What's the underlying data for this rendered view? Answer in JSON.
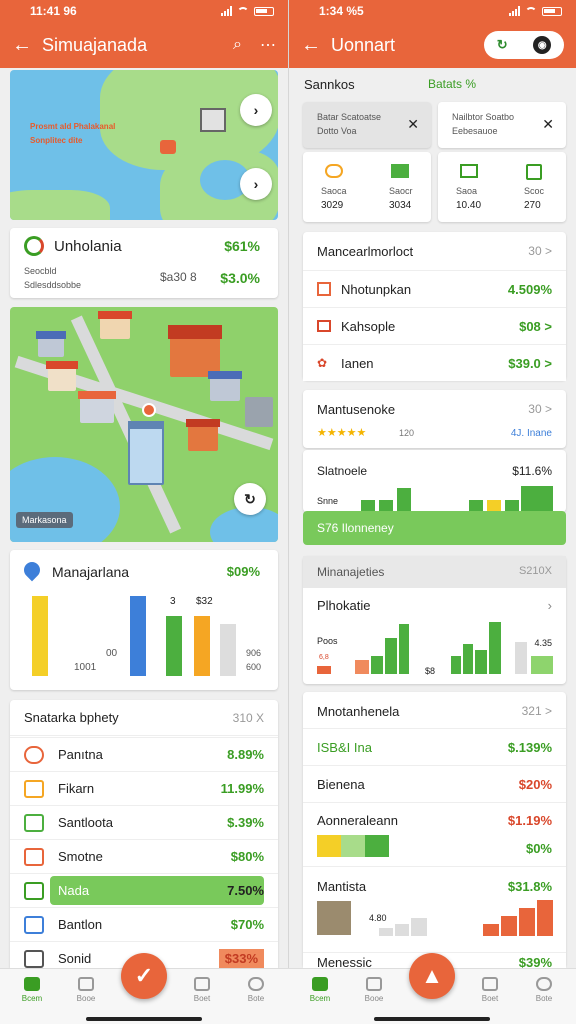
{
  "left": {
    "status": {
      "time": "11:41 96"
    },
    "appbar": {
      "title": "Simuajanada",
      "search_icon": "search-icon",
      "more_icon": "more-icon"
    },
    "map": {
      "label": "Prosmt ald Phalakanal",
      "label2": "Sonplitec dite"
    },
    "summary": {
      "title": "Unholania",
      "pct": "$61%",
      "line1": "Seocbld",
      "line2": "Sdlesddsobbe",
      "mid": "$a30 8",
      "pct2": "$3.0%"
    },
    "city": {
      "badge": "Markasona"
    },
    "chart_card": {
      "title": "Manajarlana",
      "pct": "$09%",
      "tag1": "3",
      "tag2": "$32",
      "lbl_left": "1001",
      "lbl_mid": "00",
      "lbl_right1": "906",
      "lbl_right2": "600"
    },
    "list": {
      "header": "Snatarka bphety",
      "header_right": "310 X",
      "items": [
        {
          "label": "Panıtna",
          "value": "8.89%"
        },
        {
          "label": "Fikarn",
          "value": "11.99%"
        },
        {
          "label": "Santloota",
          "value": "$.39%"
        },
        {
          "label": "Smotne",
          "value": "$80%"
        },
        {
          "label": "Nada",
          "value": "7.50%"
        },
        {
          "label": "Bantlon",
          "value": "$70%"
        },
        {
          "label": "Sonid",
          "value": "$33%"
        }
      ]
    },
    "nav": {
      "home": "Bcem",
      "second": "Booe",
      "third": "Boet",
      "fourth": "Bote"
    }
  },
  "right": {
    "status": {
      "time": "1:34 %5"
    },
    "appbar": {
      "title": "Uonnart"
    },
    "section": {
      "title": "Sannkos",
      "right": "Batats %"
    },
    "filters": [
      {
        "line1": "Batar Scatoatse",
        "line2": "Dotto Voa"
      },
      {
        "line1": "Nailbtor Soatbo",
        "line2": "Eebesauoe"
      }
    ],
    "stats": [
      {
        "name": "Saoca",
        "value": "3029"
      },
      {
        "name": "Saocr",
        "value": "3034"
      },
      {
        "name": "Saoa",
        "value": "10.40"
      },
      {
        "name": "Scoc",
        "value": "270"
      }
    ],
    "list1": {
      "header": "Mancearlmorloct",
      "header_right": "30 >",
      "items": [
        {
          "label": "Nhotunpkan",
          "value": "4.509%"
        },
        {
          "label": "Kahsople",
          "value": "$08 >"
        },
        {
          "label": "Ianen",
          "value": "$39.0 >"
        }
      ]
    },
    "rating": {
      "title": "Mantusenoke",
      "right": "30 >",
      "count": "120",
      "tag": "4J. Inane"
    },
    "spark": {
      "title": "Slatnoele",
      "value": "$11.6%",
      "sub": "Snne"
    },
    "banner": {
      "text": "S76 Ilonneney"
    },
    "group": {
      "header": "Minanajeties",
      "right": "S210X"
    },
    "chart2": {
      "title": "Plhokatie",
      "lbl1": "Poos",
      "lbl2": "4.35",
      "lbl3": "$8",
      "lbl4": "6,8"
    },
    "list2": {
      "header": "Mnotanhenela",
      "header_right": "321 >",
      "items": [
        {
          "label": "ISB&I Ina",
          "value": "$.139%"
        },
        {
          "label": "Bienena",
          "value": "$20%"
        },
        {
          "label": "Aonneraleann",
          "value": "$1.19%"
        },
        {
          "label": "",
          "value": "$0%"
        }
      ]
    },
    "final": {
      "title": "Mantista",
      "value": "$31.8%",
      "sub": "4.80"
    },
    "peek": {
      "title": "Menessic",
      "value": "$39%"
    },
    "nav": {
      "home": "Bcem",
      "second": "Booe",
      "third": "Boet",
      "fourth": "Bote"
    }
  }
}
